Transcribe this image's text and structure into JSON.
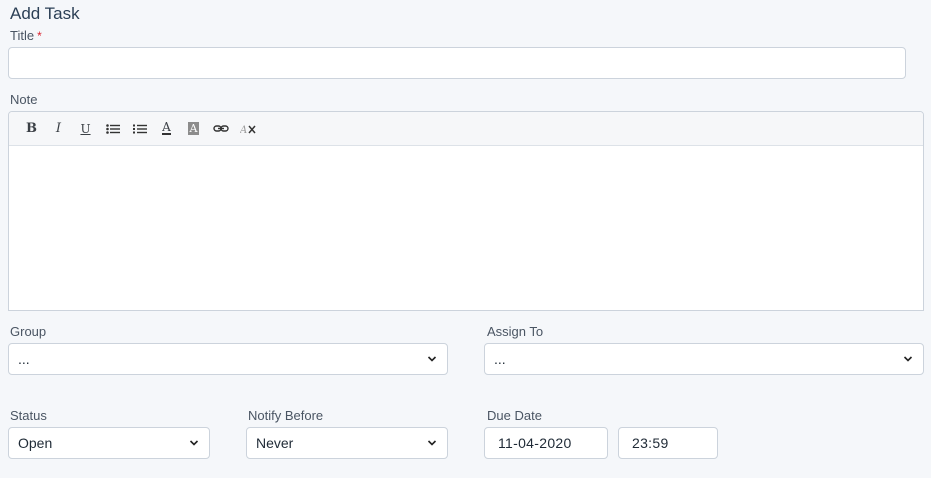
{
  "page": {
    "title": "Add Task"
  },
  "title_field": {
    "label": "Title",
    "required_marker": "*",
    "value": ""
  },
  "note_field": {
    "label": "Note",
    "toolbar": [
      {
        "icon": "bold-icon",
        "glyph": "B"
      },
      {
        "icon": "italic-icon",
        "glyph": "I"
      },
      {
        "icon": "underline-icon",
        "glyph": "U"
      },
      {
        "icon": "bulleted-list-icon"
      },
      {
        "icon": "numbered-list-icon"
      },
      {
        "icon": "text-color-icon",
        "glyph": "A"
      },
      {
        "icon": "background-color-icon",
        "glyph": "A"
      },
      {
        "icon": "link-icon"
      },
      {
        "icon": "clear-formatting-icon"
      }
    ]
  },
  "group": {
    "label": "Group",
    "value": "..."
  },
  "assign_to": {
    "label": "Assign To",
    "value": "..."
  },
  "status": {
    "label": "Status",
    "value": "Open"
  },
  "notify_before": {
    "label": "Notify Before",
    "value": "Never"
  },
  "due_date": {
    "label": "Due Date",
    "date": "11-04-2020",
    "time": "23:59"
  }
}
